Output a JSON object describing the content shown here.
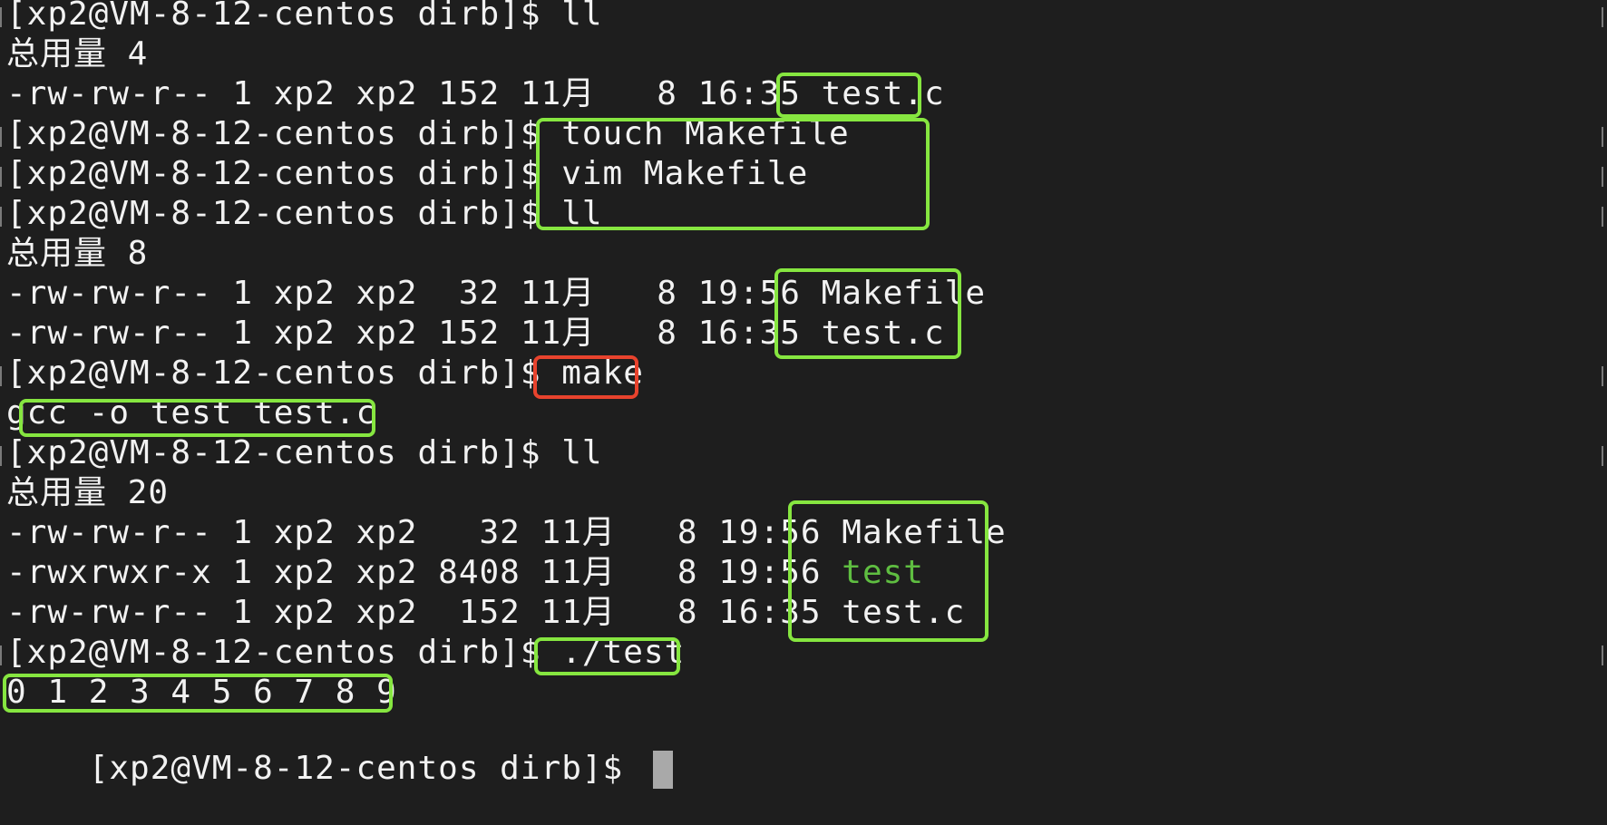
{
  "terminal": {
    "lines": [
      "[xp2@VM-8-12-centos dirb]$ ll",
      "总用量 4",
      "-rw-rw-r-- 1 xp2 xp2 152 11月   8 16:35 test.c",
      "[xp2@VM-8-12-centos dirb]$ touch Makefile",
      "[xp2@VM-8-12-centos dirb]$ vim Makefile",
      "[xp2@VM-8-12-centos dirb]$ ll",
      "总用量 8",
      "-rw-rw-r-- 1 xp2 xp2  32 11月   8 19:56 Makefile",
      "-rw-rw-r-- 1 xp2 xp2 152 11月   8 16:35 test.c",
      "[xp2@VM-8-12-centos dirb]$ make",
      "gcc -o test test.c",
      "[xp2@VM-8-12-centos dirb]$ ll",
      "总用量 20",
      "-rw-rw-r-- 1 xp2 xp2   32 11月   8 19:56 Makefile",
      {
        "prefix": "-rwxrwxr-x 1 xp2 xp2 8408 11月   8 19:56 ",
        "exec": "test"
      },
      "-rw-rw-r-- 1 xp2 xp2  152 11月   8 16:35 test.c",
      "[xp2@VM-8-12-centos dirb]$ ./test",
      "0 1 2 3 4 5 6 7 8 9"
    ],
    "prompt": "[xp2@VM-8-12-centos dirb]$ ",
    "colors": {
      "background": "#1e1e1e",
      "text": "#f2f2f2",
      "executable": "#5fbe41",
      "highlight_green": "#86e640",
      "highlight_red": "#e8432d",
      "cursor": "#a9a9a9"
    },
    "highlight_colors": [
      "green",
      "green",
      "green",
      "green",
      "red",
      "green",
      "green",
      "green",
      "green"
    ]
  }
}
